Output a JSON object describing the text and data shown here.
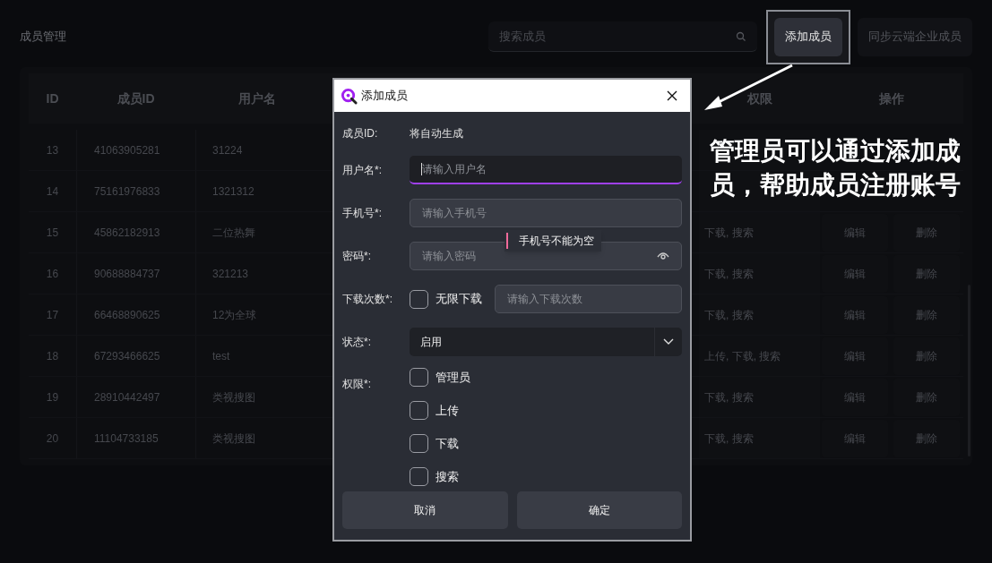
{
  "page": {
    "title": "成员管理",
    "search": {
      "placeholder": "搜索成员"
    },
    "buttons": [
      {
        "label": "添加成员",
        "highlighted": true
      },
      {
        "label": "同步云端企业成员",
        "highlighted": false
      }
    ]
  },
  "table": {
    "columns": [
      "ID",
      "成员ID",
      "用户名",
      "权限",
      "操作"
    ],
    "rows": [
      {
        "id": "13",
        "member_id": "41063905281",
        "username": "31224"
      },
      {
        "id": "14",
        "member_id": "75161976833",
        "username": "1321312"
      },
      {
        "id": "15",
        "member_id": "45862182913",
        "username": "二位热舞",
        "permissions": "下载, 搜索",
        "actions": [
          "编辑",
          "删除"
        ]
      },
      {
        "id": "16",
        "member_id": "90688884737",
        "username": "321213",
        "permissions": "下载, 搜索",
        "actions": [
          "编辑",
          "删除"
        ]
      },
      {
        "id": "17",
        "member_id": "66468890625",
        "username": "12为全球",
        "permissions": "下载, 搜索",
        "actions": [
          "编辑",
          "删除"
        ]
      },
      {
        "id": "18",
        "member_id": "67293466625",
        "username": "test",
        "permissions": "上传, 下载, 搜索",
        "actions": [
          "编辑",
          "删除"
        ]
      },
      {
        "id": "19",
        "member_id": "28910442497",
        "username": "类视搜图",
        "permissions": "下载, 搜索",
        "actions": [
          "编辑",
          "删除"
        ]
      },
      {
        "id": "20",
        "member_id": "11104733185",
        "username": "类视搜图",
        "permissions": "下载, 搜索",
        "actions": [
          "编辑",
          "删除"
        ]
      }
    ]
  },
  "dialog": {
    "title": "添加成员",
    "fields": [
      {
        "kind": "static",
        "label": "成员ID:",
        "value": "将自动生成"
      },
      {
        "kind": "input",
        "label": "用户名*:",
        "placeholder": "请输入用户名",
        "focused": true
      },
      {
        "kind": "input",
        "label": "手机号*:",
        "placeholder": "请输入手机号",
        "focused": false
      },
      {
        "kind": "password",
        "label": "密码*:",
        "placeholder": "请输入密码",
        "focused": false
      },
      {
        "kind": "count",
        "label": "下载次数*:",
        "option": {
          "label": "无限下载",
          "checked": false
        },
        "placeholder": "请输入下载次数"
      },
      {
        "kind": "select",
        "label": "状态*:",
        "value": "启用"
      },
      {
        "kind": "checkboxes",
        "label": "权限*:",
        "options": [
          {
            "label": "管理员",
            "checked": false
          },
          {
            "label": "上传",
            "checked": false
          },
          {
            "label": "下载",
            "checked": false
          },
          {
            "label": "搜索",
            "checked": false
          }
        ]
      }
    ],
    "tooltip": {
      "text": "手机号不能为空"
    },
    "buttons": [
      "取消",
      "确定"
    ]
  },
  "annotation": {
    "text": "管理员可以通过添加成员，帮助成员注册账号"
  }
}
